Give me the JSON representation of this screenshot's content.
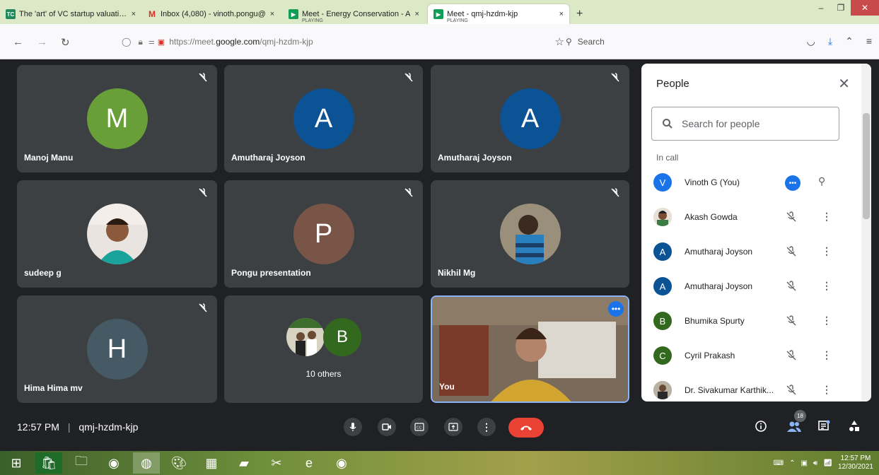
{
  "browser": {
    "tabs": [
      {
        "title": "The 'art' of VC startup valuation",
        "favicon": "tc",
        "sub": ""
      },
      {
        "title": "Inbox (4,080) - vinoth.pongu@",
        "favicon": "M",
        "sub": ""
      },
      {
        "title": "Meet - Energy Conservation - A",
        "favicon": "meet",
        "sub": "PLAYING"
      },
      {
        "title": "Meet - qmj-hzdm-kjp",
        "favicon": "meet",
        "sub": "PLAYING"
      }
    ],
    "url_prefix": "https://meet.",
    "url_domain": "google.com",
    "url_path": "/qmj-hzdm-kjp",
    "search_placeholder": "Search"
  },
  "tiles": [
    {
      "name": "Manoj Manu",
      "initial": "M",
      "color": "#689f38"
    },
    {
      "name": "Amutharaj Joyson",
      "initial": "A",
      "color": "#0b5394"
    },
    {
      "name": "Amutharaj Joyson",
      "initial": "A",
      "color": "#0b5394"
    },
    {
      "name": "sudeep g",
      "initial": "",
      "color": "#ffffff"
    },
    {
      "name": "Pongu presentation",
      "initial": "P",
      "color": "#795548"
    },
    {
      "name": "Nikhil Mg",
      "initial": "",
      "color": "#ffffff"
    },
    {
      "name": "Hima Hima mv",
      "initial": "H",
      "color": "#455a64"
    },
    {
      "name": "10 others",
      "initial": "B",
      "color": "#33691e"
    },
    {
      "name": "You",
      "initial": "",
      "color": "#000000"
    }
  ],
  "people": {
    "title": "People",
    "search_placeholder": "Search for people",
    "section": "In call",
    "list": [
      {
        "name": "Vinoth G (You)",
        "initial": "V",
        "color": "#1a73e8"
      },
      {
        "name": "Akash Gowda",
        "initial": "",
        "color": "#888888"
      },
      {
        "name": "Amutharaj Joyson",
        "initial": "A",
        "color": "#0b5394"
      },
      {
        "name": "Amutharaj Joyson",
        "initial": "A",
        "color": "#0b5394"
      },
      {
        "name": "Bhumika Spurty",
        "initial": "B",
        "color": "#33691e"
      },
      {
        "name": "Cyril Prakash",
        "initial": "C",
        "color": "#33691e"
      },
      {
        "name": "Dr. Sivakumar Karthik...",
        "initial": "",
        "color": "#777777"
      }
    ]
  },
  "bottom": {
    "time": "12:57 PM",
    "meeting_code": "qmj-hzdm-kjp",
    "participant_count": "18"
  },
  "taskbar": {
    "time": "12:57 PM",
    "date": "12/30/2021"
  }
}
